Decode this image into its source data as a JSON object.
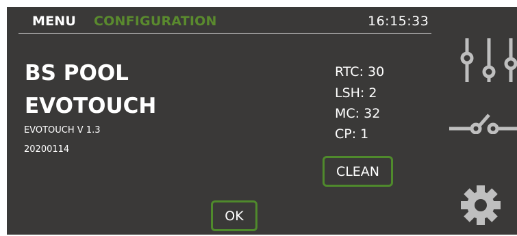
{
  "header": {
    "menu_label": "MENU",
    "section_label": "CONFIGURATION",
    "time": "16:15:33"
  },
  "device": {
    "name_line1": "BS POOL",
    "name_line2": "EVOTOUCH",
    "version": "EVOTOUCH V 1.3",
    "build": "20200114"
  },
  "stats": [
    {
      "label": "RTC",
      "value": "30",
      "text": "RTC: 30"
    },
    {
      "label": "LSH",
      "value": "2",
      "text": "LSH: 2"
    },
    {
      "label": "MC",
      "value": "32",
      "text": "MC: 32"
    },
    {
      "label": "CP",
      "value": "1",
      "text": "CP: 1"
    }
  ],
  "buttons": {
    "clean": "CLEAN",
    "ok": "OK"
  },
  "sidebar": {
    "icons": [
      "sliders-icon",
      "switch-icon",
      "gear-icon"
    ]
  },
  "colors": {
    "screen_bg": "#3a3938",
    "accent_green": "#4f8a2c",
    "section_label_green": "#5a8a2e",
    "text": "#ffffff",
    "icon_gray": "#bfbfbf"
  }
}
